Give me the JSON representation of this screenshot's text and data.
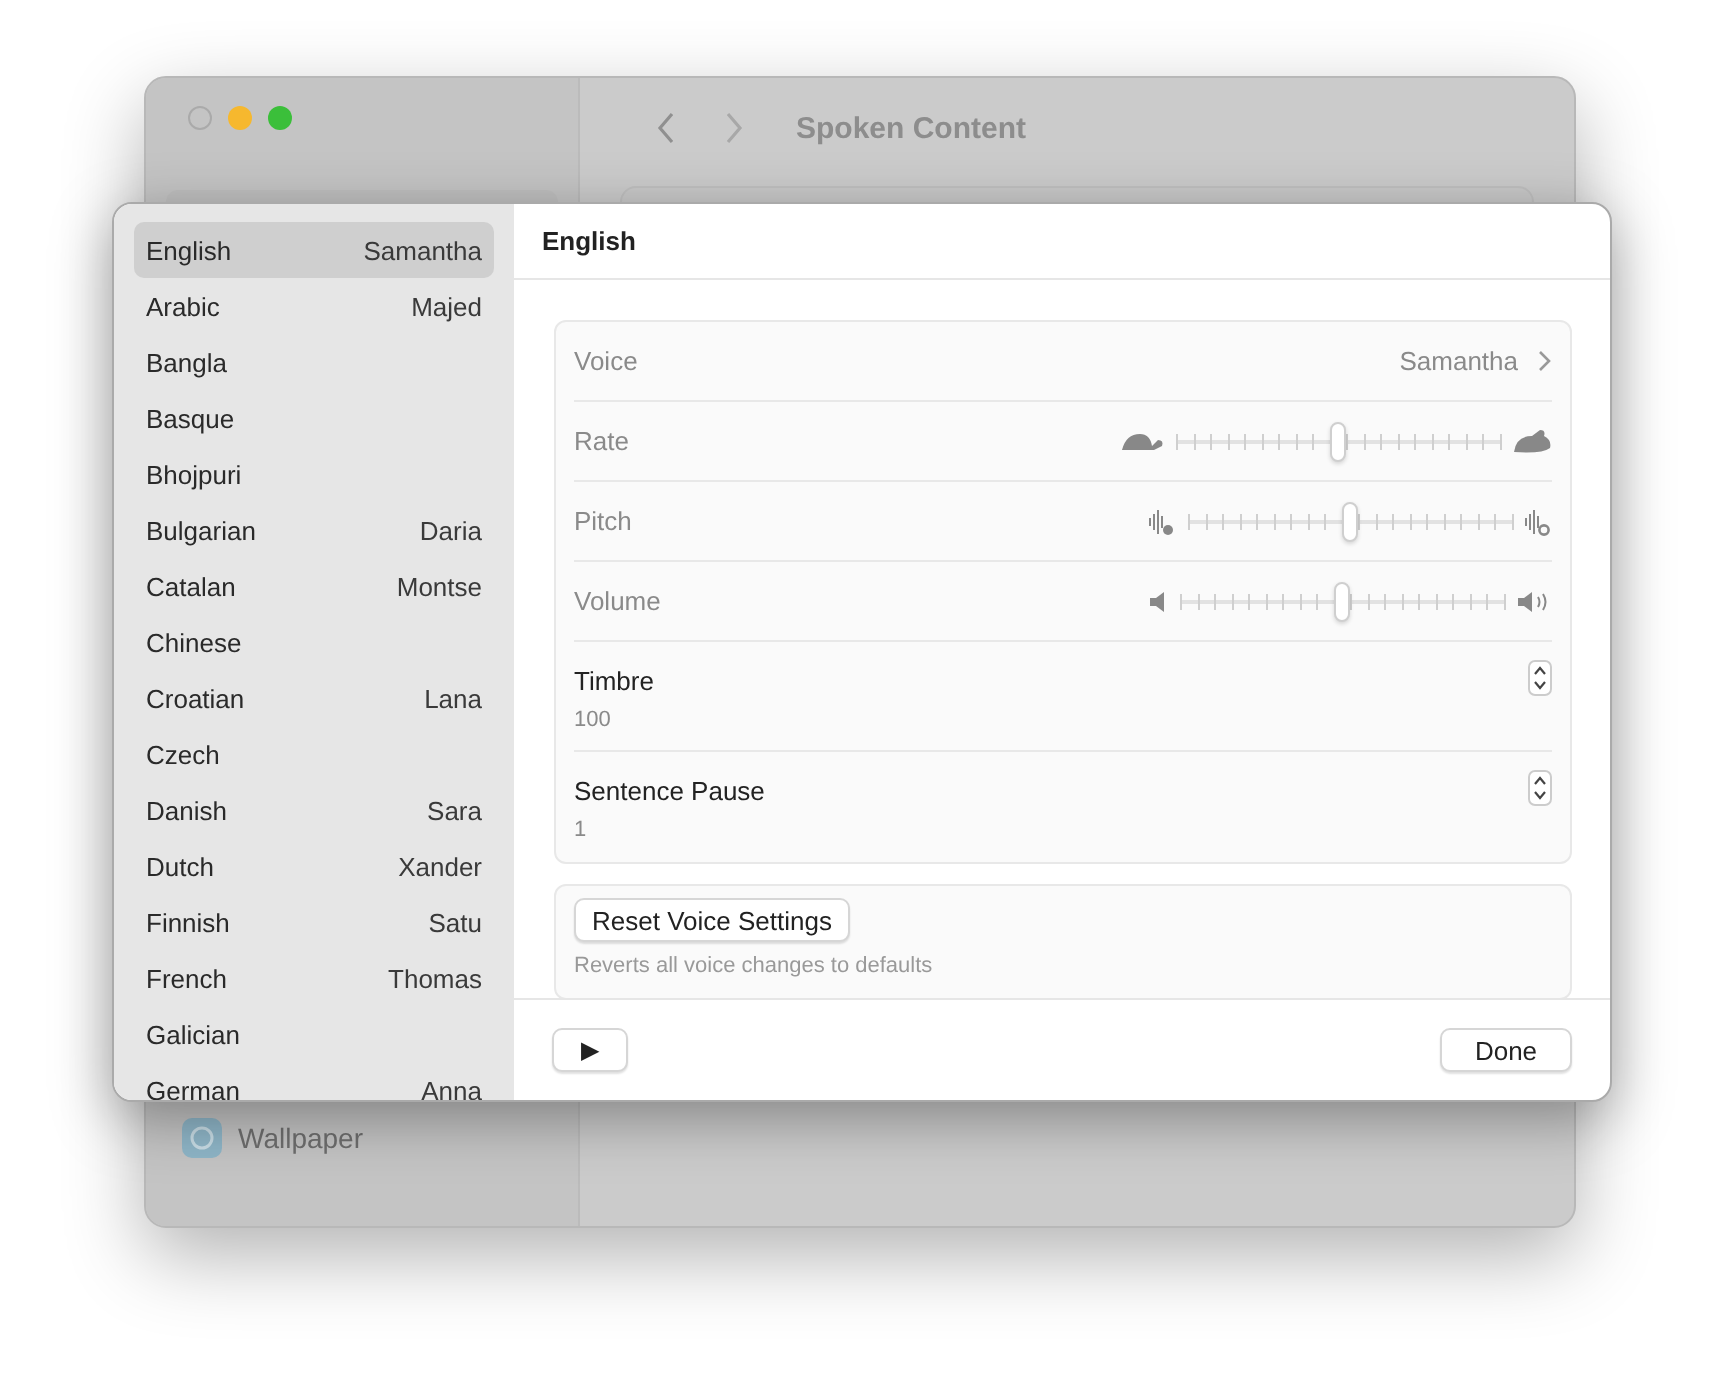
{
  "background_window": {
    "title": "Spoken Content",
    "sidebar_items": [
      {
        "label": "Wallpaper"
      }
    ]
  },
  "languages": [
    {
      "name": "English",
      "voice": "Samantha",
      "selected": true
    },
    {
      "name": "Arabic",
      "voice": "Majed",
      "selected": false
    },
    {
      "name": "Bangla",
      "selected": false
    },
    {
      "name": "Basque",
      "selected": false
    },
    {
      "name": "Bhojpuri",
      "selected": false
    },
    {
      "name": "Bulgarian",
      "voice": "Daria",
      "selected": false
    },
    {
      "name": "Catalan",
      "voice": "Montse",
      "selected": false
    },
    {
      "name": "Chinese",
      "selected": false
    },
    {
      "name": "Croatian",
      "voice": "Lana",
      "selected": false
    },
    {
      "name": "Czech",
      "selected": false
    },
    {
      "name": "Danish",
      "voice": "Sara",
      "selected": false
    },
    {
      "name": "Dutch",
      "voice": "Xander",
      "selected": false
    },
    {
      "name": "Finnish",
      "voice": "Satu",
      "selected": false
    },
    {
      "name": "French",
      "voice": "Thomas",
      "selected": false
    },
    {
      "name": "Galician",
      "selected": false
    },
    {
      "name": "German",
      "voice": "Anna",
      "selected": false
    }
  ],
  "panel_title": "English",
  "settings": [
    {
      "kind": "link",
      "label": "Voice",
      "value": "Samantha"
    },
    {
      "kind": "rate",
      "label": "Rate",
      "level": 0.5
    },
    {
      "kind": "pitch",
      "label": "Pitch",
      "level": 0.5
    },
    {
      "kind": "volume",
      "label": "Volume",
      "level": 0.5
    },
    {
      "kind": "stepper",
      "label": "Timbre",
      "value": "100"
    },
    {
      "kind": "stepper",
      "label": "Sentence Pause",
      "value": "1"
    }
  ],
  "reset": {
    "button": "Reset Voice Settings",
    "description": "Reverts all voice changes to defaults"
  },
  "footer": {
    "play_button": "▶",
    "done_button": "Done"
  }
}
